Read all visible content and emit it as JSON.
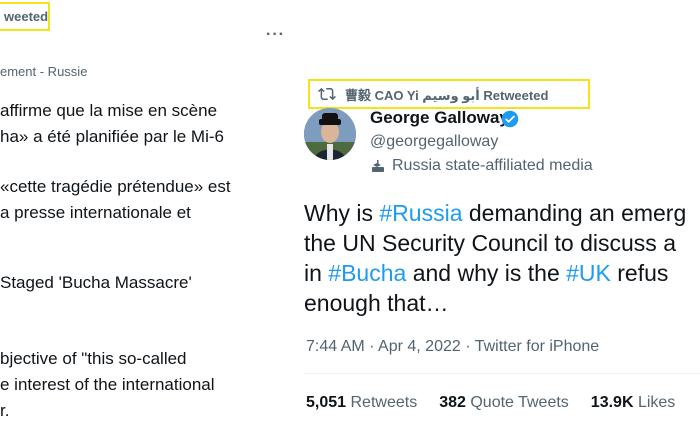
{
  "left": {
    "retweet_label": "weeted",
    "more_label": "···",
    "source_label": "ement - Russie",
    "lines": [
      "affirme que la mise en scène",
      "ha» a été planifiée par le Mi-6",
      "«cette tragédie prétendue» est",
      "a presse internationale et",
      "Staged 'Bucha Massacre'",
      "bjective of \"this so-called",
      "e interest of the international",
      "r."
    ]
  },
  "right": {
    "retweet_banner": "曹毅 CAO Yi أبو وسيم Retweeted",
    "author": {
      "name": "George Galloway",
      "handle": "@georgegalloway",
      "media_label": "Russia state-affiliated media"
    },
    "tweet": {
      "line1_pre": "Why is ",
      "line1_tag": "#Russia",
      "line1_post": " demanding an emerg",
      "line2": "the UN Security Council to discuss a",
      "line3_pre": "in ",
      "line3_tag1": "#Bucha",
      "line3_mid": " and why is the ",
      "line3_tag2": "#UK",
      "line3_post": " refus",
      "line4": "enough that…"
    },
    "meta": "7:44 AM · Apr 4, 2022 · Twitter for iPhone",
    "stats": [
      {
        "count": "5,051",
        "label": "Retweets"
      },
      {
        "count": "382",
        "label": "Quote Tweets"
      },
      {
        "count": "13.9K",
        "label": "Likes"
      }
    ]
  },
  "colors": {
    "accent": "#1d9bf0",
    "secondary_text": "#536471",
    "highlight_box": "#f5e31a"
  },
  "icons": [
    "retweet-icon",
    "verified-badge-icon",
    "state-media-icon",
    "more-icon"
  ]
}
